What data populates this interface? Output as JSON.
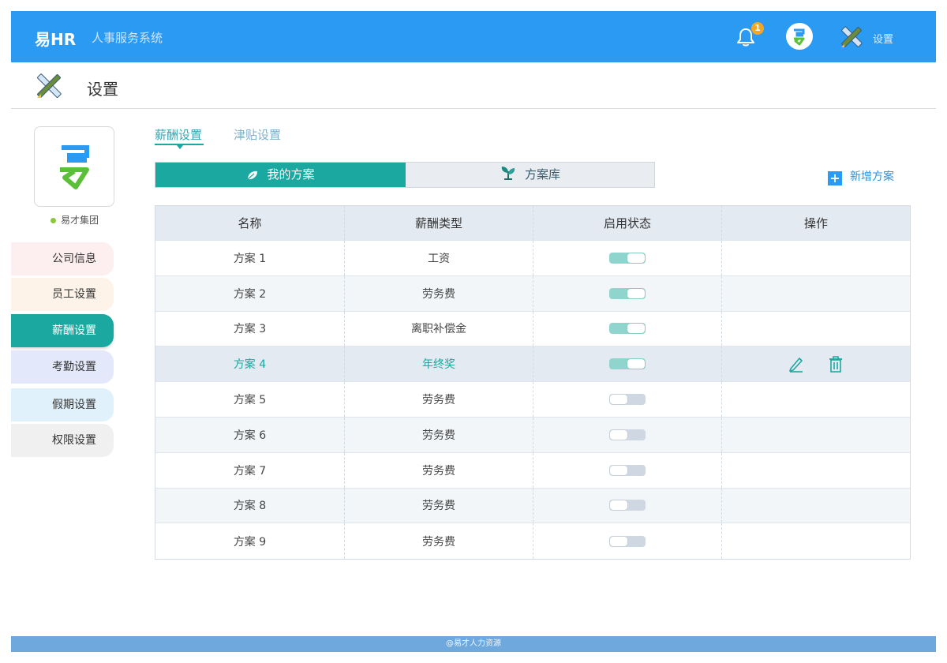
{
  "header": {
    "brand": "易HR",
    "subtitle": "人事服务系统",
    "notification_count": "1",
    "settings_label": "设置"
  },
  "page": {
    "title": "设置"
  },
  "company": {
    "name": "易才集团"
  },
  "sidebar": {
    "items": [
      {
        "label": "公司信息",
        "bg": "#fdeef0",
        "active": false
      },
      {
        "label": "员工设置",
        "bg": "#fdf3e8",
        "active": false
      },
      {
        "label": "薪酬设置",
        "bg": "#1aa8a0",
        "active": true
      },
      {
        "label": "考勤设置",
        "bg": "#e3e8fb",
        "active": false
      },
      {
        "label": "假期设置",
        "bg": "#e0f1fb",
        "active": false
      },
      {
        "label": "权限设置",
        "bg": "#f0f0f0",
        "active": false
      }
    ]
  },
  "tabs": {
    "salary_settings": "薪酬设置",
    "allowance_settings": "津贴设置"
  },
  "segment": {
    "my_plans": "我的方案",
    "plan_library": "方案库"
  },
  "add_plan_label": "新增方案",
  "table": {
    "headers": [
      "名称",
      "薪酬类型",
      "启用状态",
      "操作"
    ],
    "rows": [
      {
        "name": "方案 1",
        "type": "工资",
        "enabled": true
      },
      {
        "name": "方案 2",
        "type": "劳务费",
        "enabled": true
      },
      {
        "name": "方案 3",
        "type": "离职补偿金",
        "enabled": true
      },
      {
        "name": "方案 4",
        "type": "年终奖",
        "enabled": true,
        "selected": true
      },
      {
        "name": "方案 5",
        "type": "劳务费",
        "enabled": false
      },
      {
        "name": "方案 6",
        "type": "劳务费",
        "enabled": false
      },
      {
        "name": "方案 7",
        "type": "劳务费",
        "enabled": false
      },
      {
        "name": "方案 8",
        "type": "劳务费",
        "enabled": false
      },
      {
        "name": "方案 9",
        "type": "劳务费",
        "enabled": false
      }
    ]
  },
  "footer": {
    "text": "@易才人力资源"
  },
  "colors": {
    "header_blue": "#2b9af3",
    "accent_teal": "#1aa8a0",
    "toggle_on": "#8fd5cd",
    "toggle_off": "#cfd8e2",
    "footer_blue": "#6fa8dc"
  },
  "icons": [
    "bell-icon",
    "logo-icon",
    "tools-icon",
    "leaf-icon",
    "plant-icon",
    "plus-icon",
    "edit-icon",
    "trash-icon"
  ]
}
